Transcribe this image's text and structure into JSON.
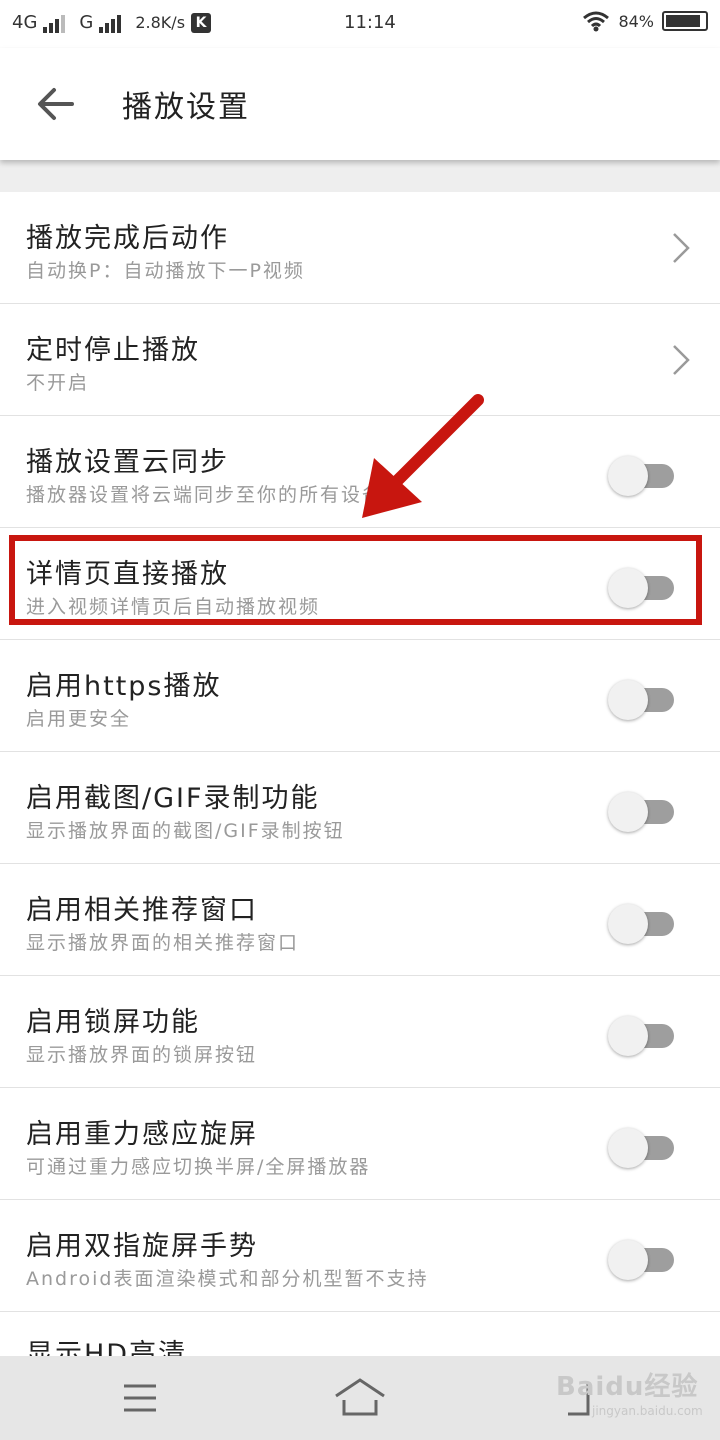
{
  "status_bar": {
    "network1": "4G",
    "network2": "G",
    "speed": "2.8K/s",
    "app_badge": "K",
    "time": "11:14",
    "battery": "84%"
  },
  "header": {
    "title": "播放设置"
  },
  "settings": [
    {
      "title": "播放完成后动作",
      "subtitle": "自动换P：自动播放下一P视频",
      "control": "chevron"
    },
    {
      "title": "定时停止播放",
      "subtitle": "不开启",
      "control": "chevron"
    },
    {
      "title": "播放设置云同步",
      "subtitle": "播放器设置将云端同步至你的所有设备",
      "control": "toggle",
      "on": false
    },
    {
      "title": "详情页直接播放",
      "subtitle": "进入视频详情页后自动播放视频",
      "control": "toggle",
      "on": false
    },
    {
      "title": "启用https播放",
      "subtitle": "启用更安全",
      "control": "toggle",
      "on": false
    },
    {
      "title": "启用截图/GIF录制功能",
      "subtitle": "显示播放界面的截图/GIF录制按钮",
      "control": "toggle",
      "on": false
    },
    {
      "title": "启用相关推荐窗口",
      "subtitle": "显示播放界面的相关推荐窗口",
      "control": "toggle",
      "on": false
    },
    {
      "title": "启用锁屏功能",
      "subtitle": "显示播放界面的锁屏按钮",
      "control": "toggle",
      "on": false
    },
    {
      "title": "启用重力感应旋屏",
      "subtitle": "可通过重力感应切换半屏/全屏播放器",
      "control": "toggle",
      "on": false
    },
    {
      "title": "启用双指旋屏手势",
      "subtitle": "Android表面渲染模式和部分机型暂不支持",
      "control": "toggle",
      "on": false
    }
  ],
  "partial_row": {
    "title": "显示HD高清"
  },
  "watermark": {
    "text": "Baidu经验",
    "url": "jingyan.baidu.com"
  },
  "colors": {
    "annotation": "#c8160f",
    "toggle_track": "#9e9e9e"
  }
}
